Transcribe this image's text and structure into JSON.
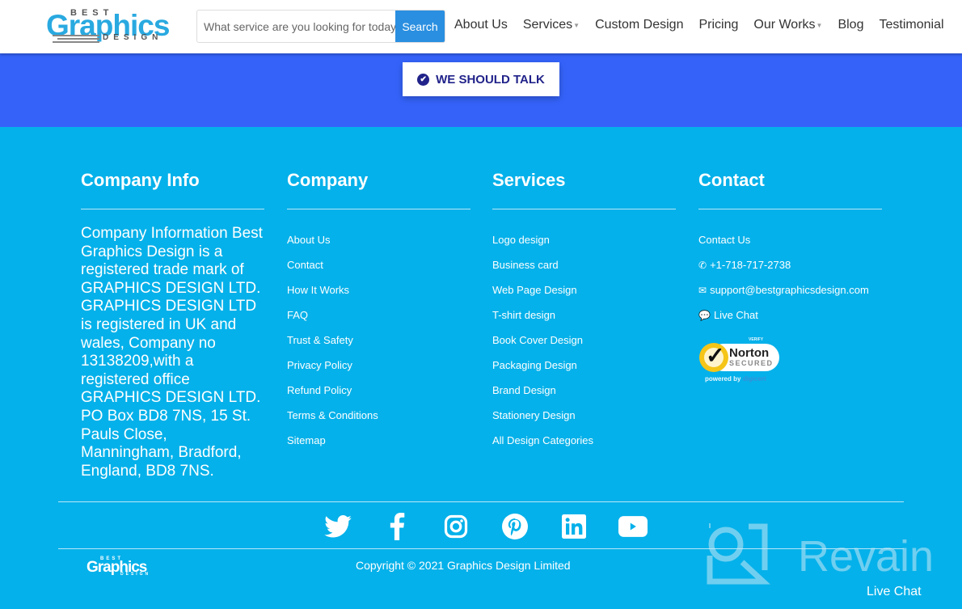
{
  "header": {
    "logo": {
      "top": "BEST",
      "main": "Graphics",
      "bottom": "DESIGN"
    },
    "search": {
      "placeholder": "What service are you looking for today",
      "button_label": "Search"
    },
    "nav": [
      {
        "label": "About Us",
        "has_dropdown": false
      },
      {
        "label": "Services",
        "has_dropdown": true
      },
      {
        "label": "Custom Design",
        "has_dropdown": false
      },
      {
        "label": "Pricing",
        "has_dropdown": false
      },
      {
        "label": "Our Works",
        "has_dropdown": true
      },
      {
        "label": "Blog",
        "has_dropdown": false
      },
      {
        "label": "Testimonial",
        "has_dropdown": false
      }
    ]
  },
  "cta": {
    "label": "WE SHOULD TALK",
    "icon": "check-circle-icon"
  },
  "footer": {
    "company_info": {
      "title": "Company Info",
      "text": "Company Information Best Graphics Design is a registered trade mark of GRAPHICS DESIGN LTD. GRAPHICS DESIGN LTD is registered in UK and wales, Company no 13138209,with a registered office GRAPHICS DESIGN LTD. PO Box BD8 7NS, 15 St. Pauls Close, Manningham, Bradford, England, BD8 7NS."
    },
    "company": {
      "title": "Company",
      "links": [
        "About Us",
        "Contact",
        "How It Works",
        "FAQ",
        "Trust & Safety",
        "Privacy Policy",
        "Refund Policy",
        "Terms & Conditions",
        "Sitemap"
      ]
    },
    "services": {
      "title": "Services",
      "links": [
        "Logo design",
        "Business card",
        "Web Page Design",
        "T-shirt design",
        "Book Cover Design",
        "Packaging Design",
        "Brand Design",
        "Stationery Design",
        "All Design Categories"
      ]
    },
    "contact": {
      "title": "Contact",
      "contact_us": "Contact Us",
      "phone": "+1-718-717-2738",
      "email": "support@bestgraphicsdesign.com",
      "live_chat": "Live Chat",
      "norton": {
        "verify": "VERIFY",
        "brand": "Norton",
        "secured": "SECURED",
        "powered": "powered by",
        "by": "digicert"
      }
    },
    "social": [
      "twitter-icon",
      "facebook-icon",
      "instagram-icon",
      "pinterest-icon",
      "linkedin-icon",
      "youtube-icon"
    ],
    "copyright": "Copyright © 2021 Graphics Design Limited",
    "small_logo": {
      "top": "BEST",
      "main": "Graphics",
      "bottom": "DESIGN"
    }
  },
  "overlay": {
    "revain": "Revain",
    "live_chat": "Live Chat"
  },
  "colors": {
    "cta_band": "#3563fa",
    "footer_bg": "#05b1ea",
    "search_button": "#2a8fe0",
    "cta_text": "#22238a"
  }
}
